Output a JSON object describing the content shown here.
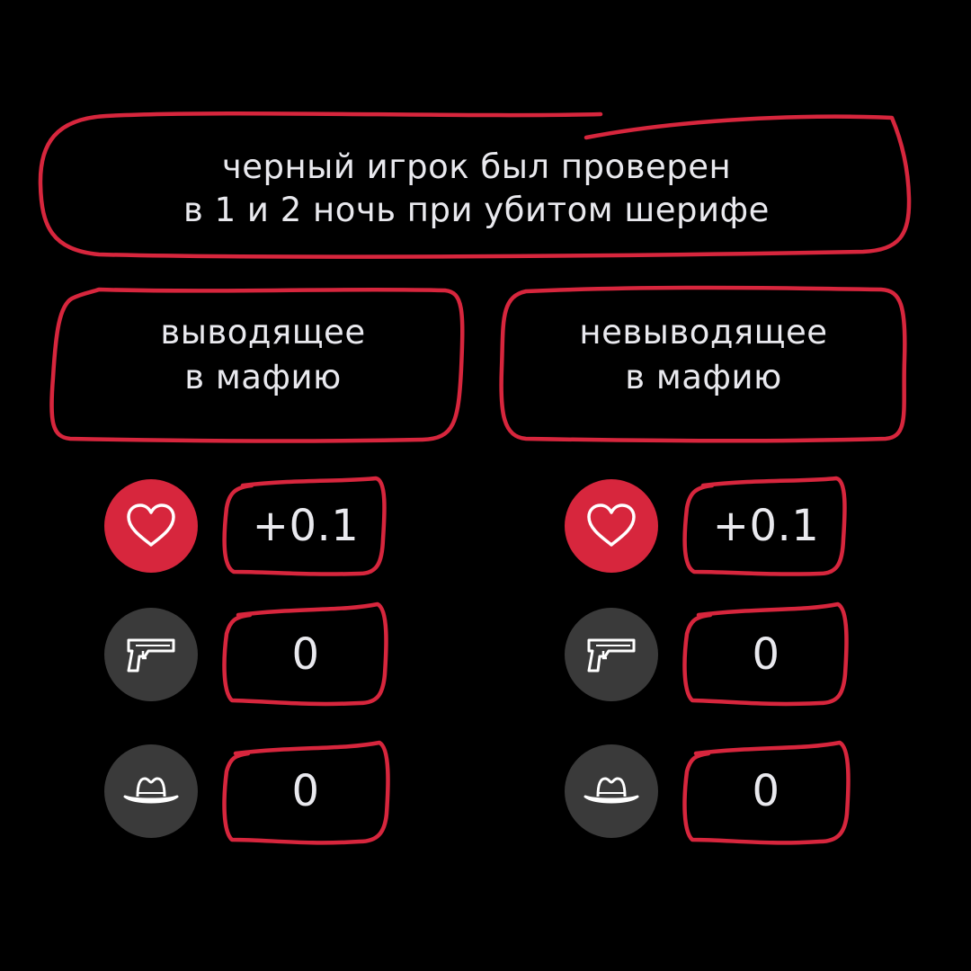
{
  "title": {
    "line1": "черный игрок был проверен",
    "line2": "в 1 и 2 ночь при убитом шерифе"
  },
  "columns": [
    {
      "heading_line1": "выводящее",
      "heading_line2": "в мафию",
      "rows": [
        {
          "icon": "heart-icon",
          "value": "+0.1"
        },
        {
          "icon": "pistol-icon",
          "value": "0"
        },
        {
          "icon": "hat-icon",
          "value": "0"
        }
      ]
    },
    {
      "heading_line1": "невыводящее",
      "heading_line2": "в мафию",
      "rows": [
        {
          "icon": "heart-icon",
          "value": "+0.1"
        },
        {
          "icon": "pistol-icon",
          "value": "0"
        },
        {
          "icon": "hat-icon",
          "value": "0"
        }
      ]
    }
  ],
  "colors": {
    "background": "#000000",
    "accent_red": "#d7263d",
    "icon_gray": "#3a3a3a",
    "text": "#e9e9ee"
  }
}
